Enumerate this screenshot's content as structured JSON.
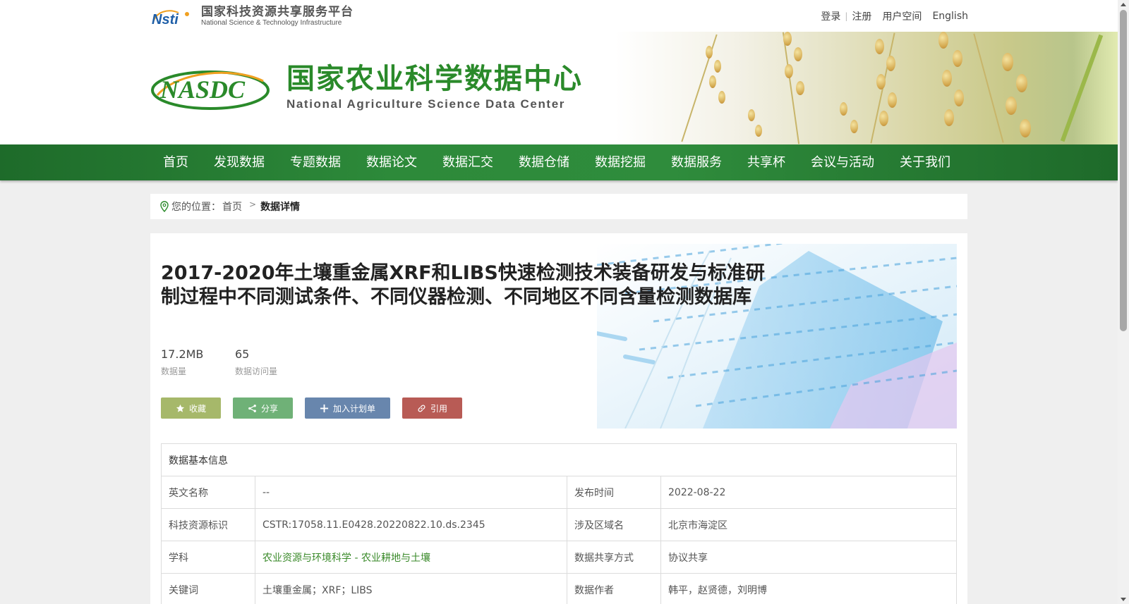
{
  "header": {
    "nsti_name_cn": "国家科技资源共享服务平台",
    "nsti_name_en": "National Science & Technology Infrastructure",
    "links": {
      "login": "登录",
      "sep": "|",
      "register": "注册",
      "user_space": "用户空间",
      "english": "English"
    }
  },
  "banner": {
    "title_cn": "国家农业科学数据中心",
    "title_en": "National Agriculture Science Data Center"
  },
  "nav": {
    "items": [
      "首页",
      "发现数据",
      "专题数据",
      "数据论文",
      "数据汇交",
      "数据仓储",
      "数据挖掘",
      "数据服务",
      "共享杯",
      "会议与活动",
      "关于我们"
    ]
  },
  "breadcrumb": {
    "prefix": "您的位置：",
    "home": "首页",
    "arrow": ">",
    "current": "数据详情"
  },
  "dataset": {
    "title": "2017-2020年土壤重金属XRF和LIBS快速检测技术装备研发与标准研制过程中不同测试条件、不同仪器检测、不同地区不同含量检测数据库",
    "size_value": "17.2MB",
    "size_label": "数据量",
    "visits_value": "65",
    "visits_label": "数据访问量"
  },
  "actions": {
    "favorite": "收藏",
    "share": "分享",
    "add_plan": "加入计划单",
    "cite": "引用"
  },
  "info": {
    "heading": "数据基本信息",
    "rows": [
      {
        "k1": "英文名称",
        "v1": "--",
        "k2": "发布时间",
        "v2": "2022-08-22"
      },
      {
        "k1": "科技资源标识",
        "v1": "CSTR:17058.11.E0428.20220822.10.ds.2345",
        "k2": "涉及区域名",
        "v2": "北京市海淀区"
      },
      {
        "k1": "学科",
        "v1": "农业资源与环境科学 - 农业耕地与土壤",
        "k2": "数据共享方式",
        "v2": "协议共享"
      },
      {
        "k1": "关键词",
        "v1": "土壤重金属；XRF；LIBS",
        "k2": "数据作者",
        "v2": "韩平，赵贤德，刘明博"
      }
    ]
  },
  "colors": {
    "nav_green": "#2d8a3a",
    "brand_green": "#2a8a2a",
    "favorite": "#a6b86a",
    "share": "#6fb177",
    "plan": "#6886ad",
    "cite": "#b85b55"
  }
}
